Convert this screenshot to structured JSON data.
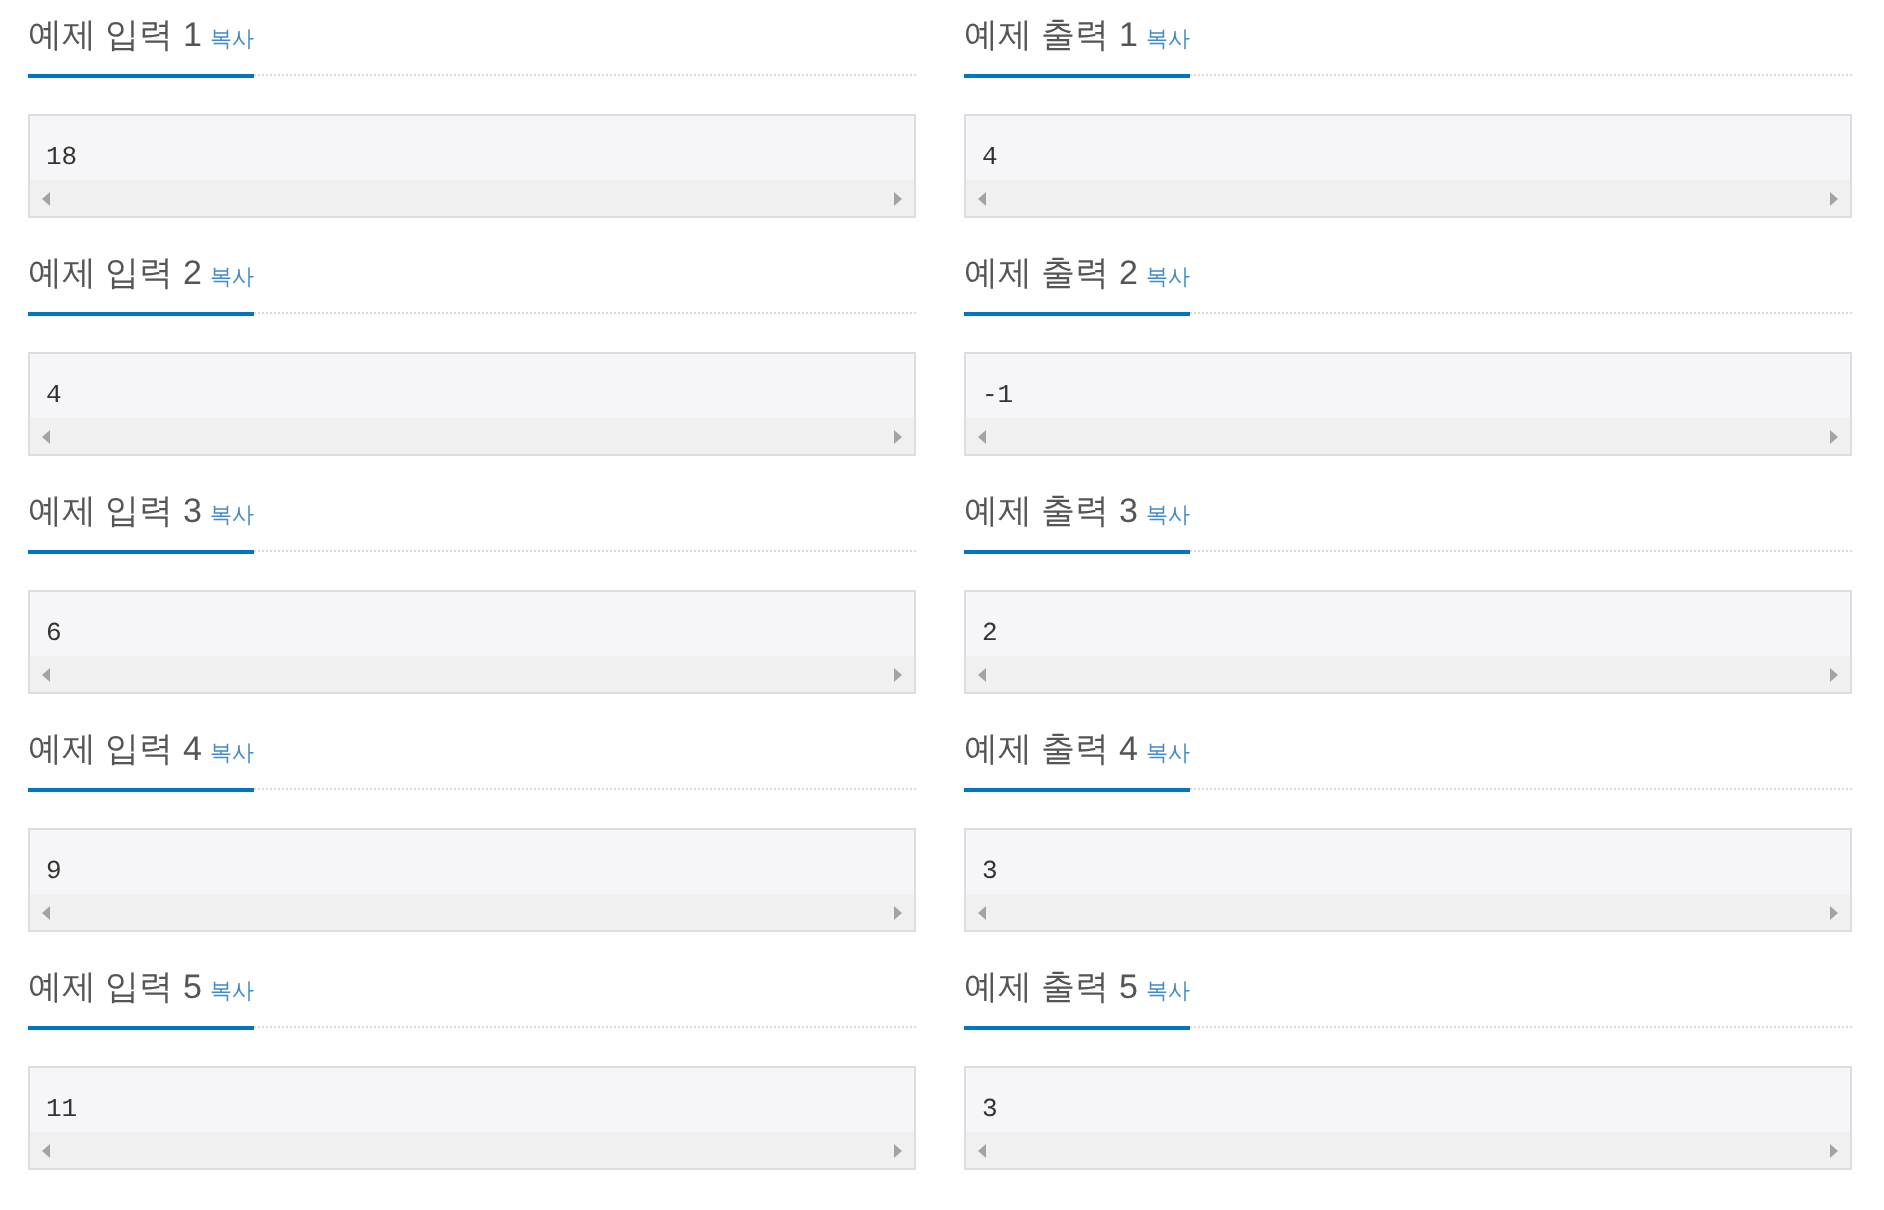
{
  "samples": [
    {
      "input": {
        "title": "예제 입력 1",
        "copy": "복사",
        "content": "18"
      },
      "output": {
        "title": "예제 출력 1",
        "copy": "복사",
        "content": "4"
      }
    },
    {
      "input": {
        "title": "예제 입력 2",
        "copy": "복사",
        "content": "4"
      },
      "output": {
        "title": "예제 출력 2",
        "copy": "복사",
        "content": "-1"
      }
    },
    {
      "input": {
        "title": "예제 입력 3",
        "copy": "복사",
        "content": "6"
      },
      "output": {
        "title": "예제 출력 3",
        "copy": "복사",
        "content": "2"
      }
    },
    {
      "input": {
        "title": "예제 입력 4",
        "copy": "복사",
        "content": "9"
      },
      "output": {
        "title": "예제 출력 4",
        "copy": "복사",
        "content": "3"
      }
    },
    {
      "input": {
        "title": "예제 입력 5",
        "copy": "복사",
        "content": "11"
      },
      "output": {
        "title": "예제 출력 5",
        "copy": "복사",
        "content": "3"
      }
    }
  ]
}
